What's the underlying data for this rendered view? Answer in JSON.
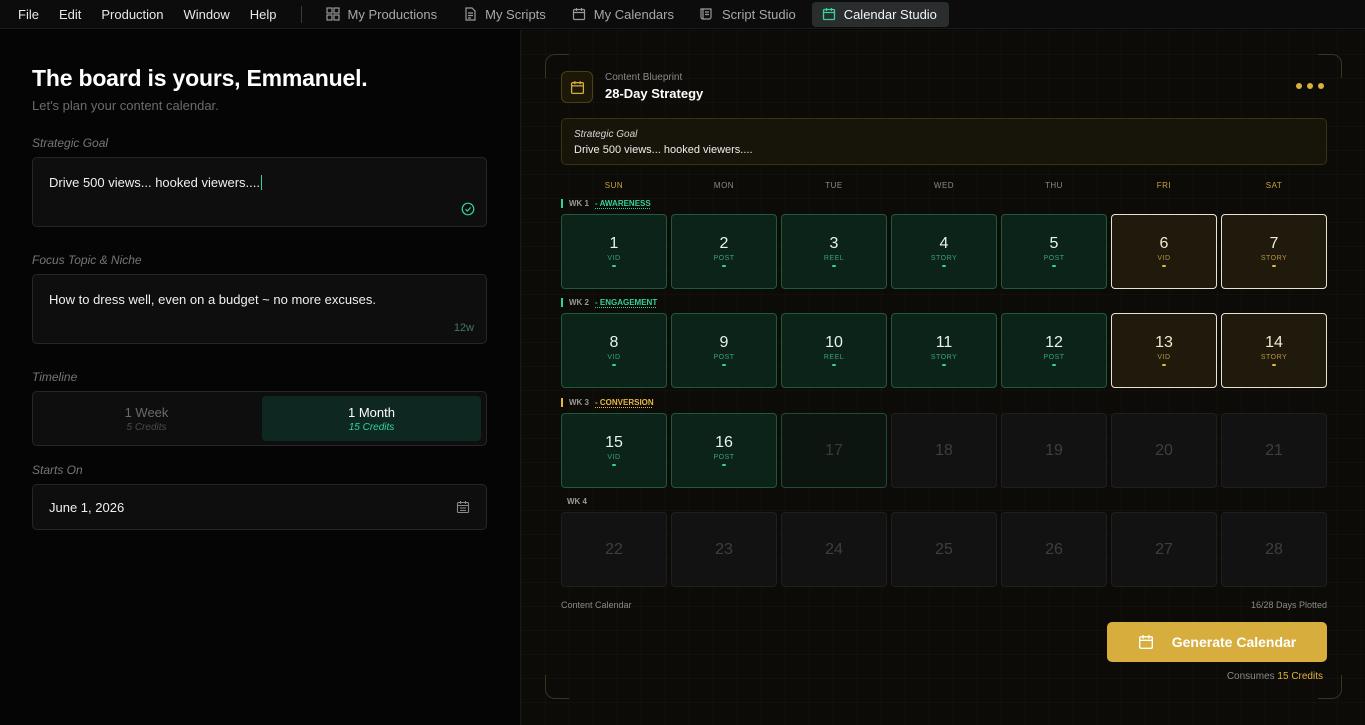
{
  "menu": [
    "File",
    "Edit",
    "Production",
    "Window",
    "Help"
  ],
  "tabs": [
    {
      "label": "My Productions",
      "icon": "grid-icon",
      "active": false
    },
    {
      "label": "My Scripts",
      "icon": "document-icon",
      "active": false
    },
    {
      "label": "My Calendars",
      "icon": "calendar-icon",
      "active": false
    },
    {
      "label": "Script Studio",
      "icon": "script-icon",
      "active": false
    },
    {
      "label": "Calendar Studio",
      "icon": "calendar-icon",
      "active": true
    }
  ],
  "left": {
    "greeting": "The board is yours, Emmanuel.",
    "subtitle": "Let's plan your content calendar.",
    "goal_label": "Strategic Goal",
    "goal_value": "Drive 500 views... hooked viewers....",
    "topic_label": "Focus Topic & Niche",
    "topic_value": "How to dress well, even on a budget ~ no more excuses.",
    "topic_count": "12w",
    "timeline_label": "Timeline",
    "timeline_options": [
      {
        "label": "1 Week",
        "credits": "5 Credits",
        "selected": false
      },
      {
        "label": "1 Month",
        "credits": "15 Credits",
        "selected": true
      }
    ],
    "starts_label": "Starts On",
    "starts_value": "June 1, 2026"
  },
  "right": {
    "kicker": "Content Blueprint",
    "title": "28-Day Strategy",
    "goal_label": "Strategic Goal",
    "goal_value": "Drive 500 views... hooked viewers....",
    "days": [
      "SUN",
      "MON",
      "TUE",
      "WED",
      "THU",
      "FRI",
      "SAT"
    ],
    "weeks": [
      {
        "label": "WK 1",
        "phase": "- AWARENESS",
        "color": "#34d399"
      },
      {
        "label": "WK 2",
        "phase": "- ENGAGEMENT",
        "color": "#34d399"
      },
      {
        "label": "WK 3",
        "phase": "- CONVERSION",
        "color": "#e6b741"
      },
      {
        "label": "WK 4",
        "phase": "",
        "color": ""
      }
    ],
    "cells": [
      {
        "day": "1",
        "type": "VID",
        "state": "green"
      },
      {
        "day": "2",
        "type": "POST",
        "state": "green"
      },
      {
        "day": "3",
        "type": "REEL",
        "state": "green"
      },
      {
        "day": "4",
        "type": "STORY",
        "state": "green"
      },
      {
        "day": "5",
        "type": "POST",
        "state": "green"
      },
      {
        "day": "6",
        "type": "VID",
        "state": "gold"
      },
      {
        "day": "7",
        "type": "STORY",
        "state": "gold"
      },
      {
        "day": "8",
        "type": "VID",
        "state": "green"
      },
      {
        "day": "9",
        "type": "POST",
        "state": "green"
      },
      {
        "day": "10",
        "type": "REEL",
        "state": "green"
      },
      {
        "day": "11",
        "type": "STORY",
        "state": "green"
      },
      {
        "day": "12",
        "type": "POST",
        "state": "green"
      },
      {
        "day": "13",
        "type": "VID",
        "state": "gold"
      },
      {
        "day": "14",
        "type": "STORY",
        "state": "gold"
      },
      {
        "day": "15",
        "type": "VID",
        "state": "green"
      },
      {
        "day": "16",
        "type": "POST",
        "state": "green"
      },
      {
        "day": "17",
        "type": "",
        "state": "next"
      },
      {
        "day": "18",
        "type": "",
        "state": "empty"
      },
      {
        "day": "19",
        "type": "",
        "state": "empty"
      },
      {
        "day": "20",
        "type": "",
        "state": "empty"
      },
      {
        "day": "21",
        "type": "",
        "state": "empty"
      },
      {
        "day": "22",
        "type": "",
        "state": "empty"
      },
      {
        "day": "23",
        "type": "",
        "state": "empty"
      },
      {
        "day": "24",
        "type": "",
        "state": "empty"
      },
      {
        "day": "25",
        "type": "",
        "state": "empty"
      },
      {
        "day": "26",
        "type": "",
        "state": "empty"
      },
      {
        "day": "27",
        "type": "",
        "state": "empty"
      },
      {
        "day": "28",
        "type": "",
        "state": "empty"
      }
    ],
    "footer_left": "Content Calendar",
    "footer_right": "16/28 Days Plotted",
    "generate_label": "Generate Calendar",
    "consumes_prefix": "Consumes",
    "consumes_value": "15 Credits",
    "colors": {
      "accent_gold": "#d7ae3d",
      "accent_green": "#34d399"
    }
  }
}
